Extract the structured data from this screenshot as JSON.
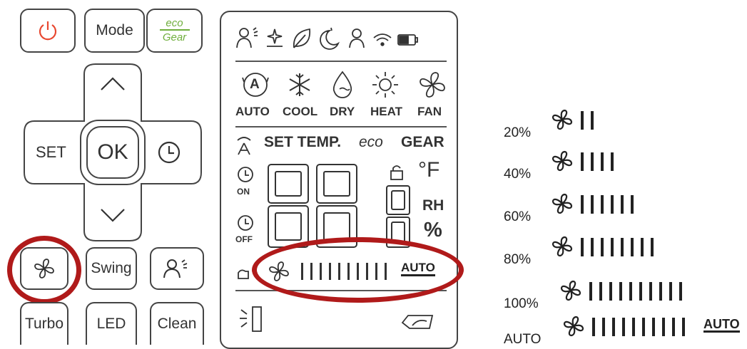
{
  "remote": {
    "mode_label": "Mode",
    "eco_top": "eco",
    "eco_bottom": "Gear",
    "set_label": "SET",
    "ok_label": "OK",
    "swing_label": "Swing",
    "turbo_label": "Turbo",
    "led_label": "LED",
    "clean_label": "Clean"
  },
  "lcd": {
    "modes": [
      "AUTO",
      "COOL",
      "DRY",
      "HEAT",
      "FAN"
    ],
    "auto_mode_glyph": "A",
    "set_temp_label": "SET TEMP.",
    "eco_label": "eco",
    "gear_label": "GEAR",
    "on_label": "ON",
    "off_label": "OFF",
    "unit_f": "°F",
    "unit_rh": "RH",
    "unit_pct": "%",
    "fan_auto_label": "AUTO"
  },
  "fan_levels": [
    {
      "label": "20%",
      "bars": 2
    },
    {
      "label": "40%",
      "bars": 4
    },
    {
      "label": "60%",
      "bars": 6
    },
    {
      "label": "80%",
      "bars": 8
    },
    {
      "label": "100%",
      "bars": 10
    },
    {
      "label": "AUTO",
      "bars": 10,
      "auto_tag": "AUTO"
    }
  ],
  "colors": {
    "highlight": "#b01a1a",
    "eco_green": "#6fae3c",
    "power_red": "#e8472f"
  }
}
